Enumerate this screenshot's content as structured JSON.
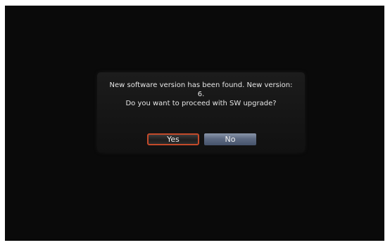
{
  "dialog": {
    "message_lines": [
      "New software version has been found. New version:",
      "6.",
      "Do you want to proceed with SW upgrade?"
    ],
    "buttons": {
      "yes_label": "Yes",
      "no_label": "No",
      "focused": "Yes"
    }
  },
  "colors": {
    "screen_background": "#0a0a0a",
    "dialog_background": "#151515",
    "text": "#e6e6e6",
    "focus_border": "#c34a2a",
    "no_button": "#5d6a82"
  }
}
